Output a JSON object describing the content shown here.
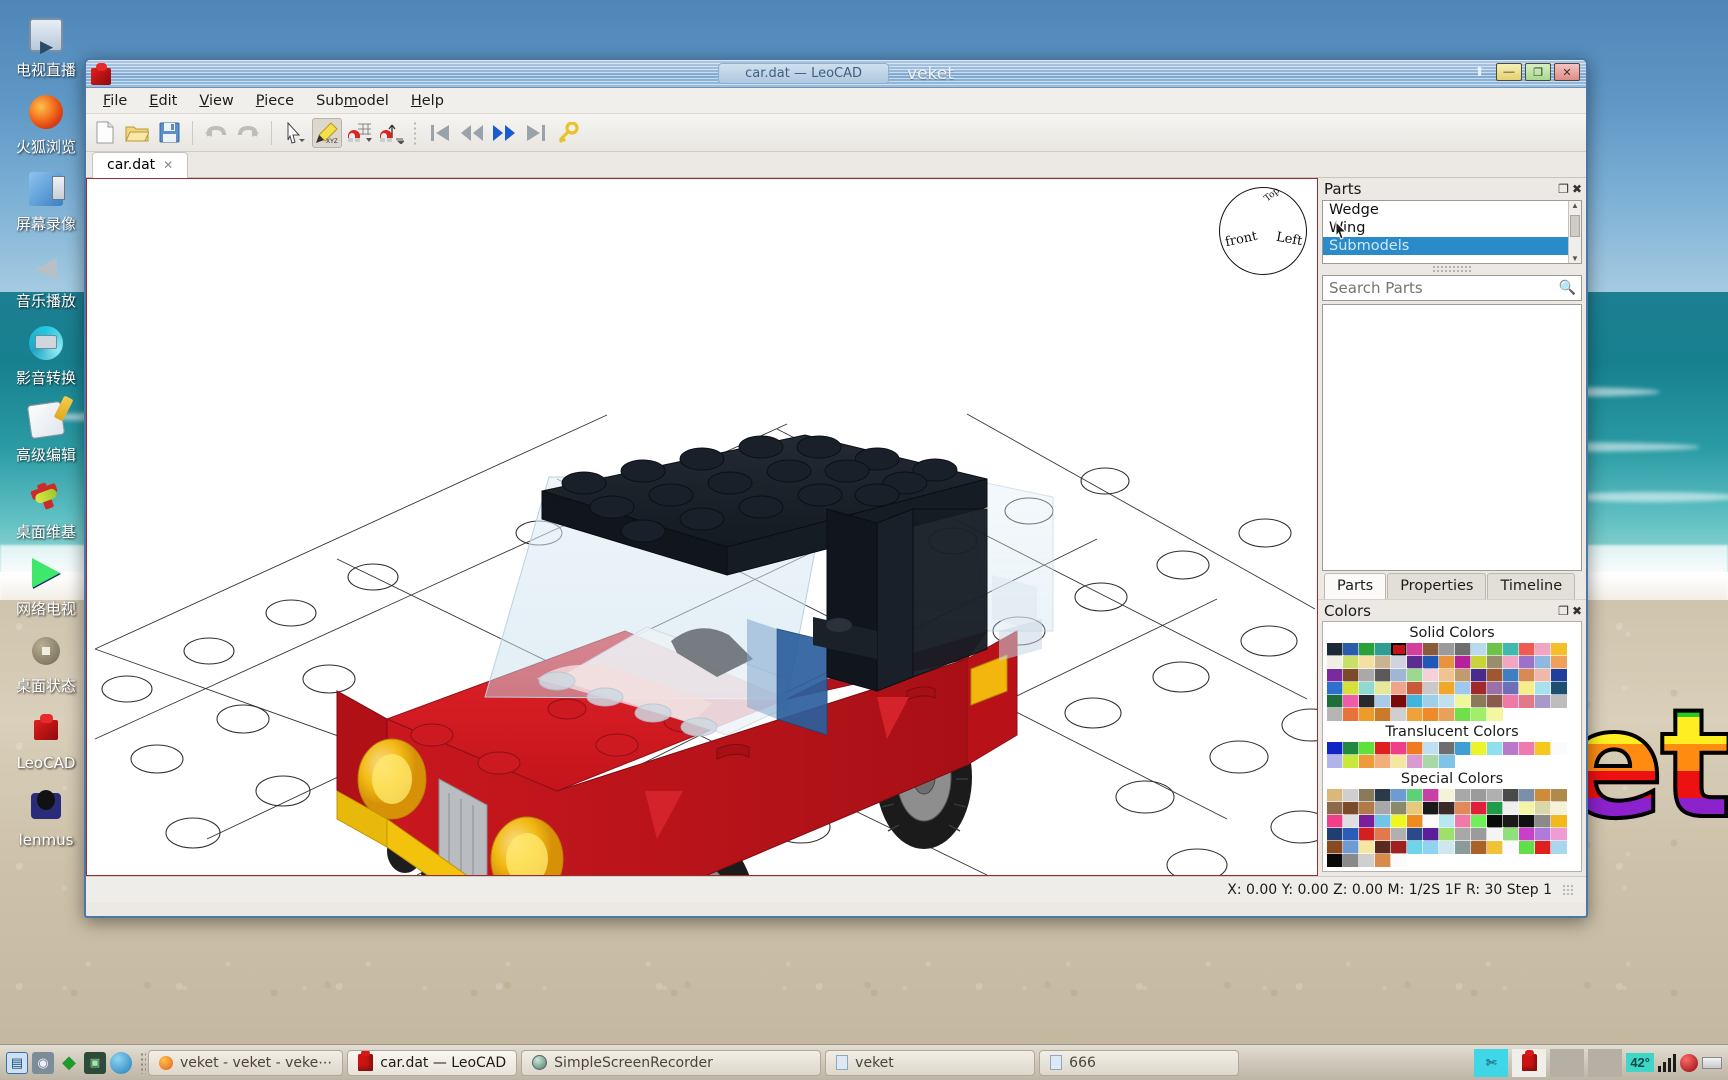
{
  "desktop": {
    "icons": [
      {
        "label": "电视直播",
        "icon": "tv-live-icon",
        "color": "#c8d4e4",
        "glyph": "▶"
      },
      {
        "label": "火狐浏览",
        "icon": "firefox-browser-icon",
        "color": "#e8701a",
        "glyph": "🦊"
      },
      {
        "label": "屏幕录像",
        "icon": "screen-recorder-icon",
        "color": "#5b9bd5",
        "glyph": "🎞"
      },
      {
        "label": "音乐播放",
        "icon": "music-player-icon",
        "color": "#9aa7b4",
        "glyph": "🔊"
      },
      {
        "label": "影音转换",
        "icon": "media-converter-icon",
        "color": "#1fb9d6",
        "glyph": "⟳"
      },
      {
        "label": "高级编辑",
        "icon": "advanced-editor-icon",
        "color": "#f0e36b",
        "glyph": "✎"
      },
      {
        "label": "桌面维基",
        "icon": "desktop-wiki-icon",
        "color": "#cf3030",
        "glyph": "✈"
      },
      {
        "label": "网络电视",
        "icon": "network-tv-icon",
        "color": "#3fdd6a",
        "glyph": "▷"
      },
      {
        "label": "桌面状态",
        "icon": "desktop-status-icon",
        "color": "#8d8676",
        "glyph": "◉"
      },
      {
        "label": "LeoCAD",
        "icon": "leocad-icon",
        "color": "#cc1414",
        "glyph": "▮"
      },
      {
        "label": "lenmus",
        "icon": "lenmus-icon",
        "color": "#2b2b6b",
        "glyph": "◐"
      }
    ],
    "wallpaper_text": "et"
  },
  "window": {
    "app_icon": "leocad-brick-icon",
    "document_title": "car.dat — LeoCAD",
    "wm_title": "veket",
    "controls": {
      "shade": "⬆",
      "minimize": "—",
      "maximize": "❐",
      "close": "✕"
    }
  },
  "menubar": {
    "items": [
      {
        "label": "File",
        "mnemonic": "F"
      },
      {
        "label": "Edit",
        "mnemonic": "E"
      },
      {
        "label": "View",
        "mnemonic": "V"
      },
      {
        "label": "Piece",
        "mnemonic": "P"
      },
      {
        "label": "Submodel",
        "mnemonic": "m"
      },
      {
        "label": "Help",
        "mnemonic": "H"
      }
    ]
  },
  "toolbar": {
    "buttons": [
      {
        "name": "new-file-button",
        "icon": "new-document-icon",
        "tooltip": "New"
      },
      {
        "name": "open-file-button",
        "icon": "open-folder-icon",
        "tooltip": "Open"
      },
      {
        "name": "save-file-button",
        "icon": "save-floppy-icon",
        "tooltip": "Save"
      },
      {
        "name": "undo-button",
        "icon": "undo-arrow-icon",
        "tooltip": "Undo"
      },
      {
        "name": "redo-button",
        "icon": "redo-arrow-icon",
        "tooltip": "Redo"
      },
      {
        "name": "select-tool-button",
        "icon": "cursor-arrow-icon",
        "tooltip": "Select"
      },
      {
        "name": "move-tool-button",
        "icon": "magic-wand-xyz-icon",
        "tooltip": "Move XYZ"
      },
      {
        "name": "snap-grid-button",
        "icon": "magnet-grid-icon",
        "tooltip": "Snap to Grid"
      },
      {
        "name": "snap-angle-button",
        "icon": "magnet-angle-icon",
        "tooltip": "Snap Angle"
      },
      {
        "name": "first-step-button",
        "icon": "skip-first-icon",
        "tooltip": "First Step"
      },
      {
        "name": "prev-step-button",
        "icon": "rewind-icon",
        "tooltip": "Previous Step"
      },
      {
        "name": "next-step-button",
        "icon": "fast-forward-icon",
        "tooltip": "Next Step"
      },
      {
        "name": "last-step-button",
        "icon": "skip-last-icon",
        "tooltip": "Last Step"
      },
      {
        "name": "key-button",
        "icon": "key-icon",
        "tooltip": "Keys"
      }
    ]
  },
  "document_tabs": [
    {
      "label": "car.dat",
      "close": "✕",
      "active": true
    }
  ],
  "viewport": {
    "model_name": "car.dat",
    "viewcube": {
      "front_label": "front",
      "left_label": "Left",
      "top_label": "Top"
    }
  },
  "parts_panel": {
    "title": "Parts",
    "float_icon": "float-panel-icon",
    "close_icon": "close-panel-icon",
    "categories": [
      {
        "label": "Wedge",
        "selected": false
      },
      {
        "label": "Wing",
        "selected": false
      },
      {
        "label": "Submodels",
        "selected": true
      }
    ],
    "search": {
      "placeholder": "Search Parts",
      "value": "",
      "icon": "search-magnifier-icon"
    }
  },
  "dock_tabs": [
    {
      "label": "Parts",
      "active": true
    },
    {
      "label": "Properties",
      "active": false
    },
    {
      "label": "Timeline",
      "active": false
    }
  ],
  "colors_panel": {
    "title": "Colors",
    "float_icon": "float-panel-icon",
    "close_icon": "close-panel-icon",
    "groups": [
      {
        "heading": "Solid Colors",
        "selected_index": 4,
        "swatches": [
          "#1b2a34",
          "#2a5ca8",
          "#2aa13a",
          "#2f9d94",
          "#c1121a",
          "#d43f9d",
          "#8a5a3c",
          "#9b9b9b",
          "#6e6e6e",
          "#b9d9ef",
          "#6fc24a",
          "#3fb9b0",
          "#ef5b52",
          "#f0a6c0",
          "#f4c02a",
          "#f0efe6",
          "#c8e06a",
          "#f5dfa3",
          "#cbb391",
          "#cfd4df",
          "#5c2d8e",
          "#1f58b5",
          "#e8943e",
          "#b4219b",
          "#c8d43a",
          "#9a8c6e",
          "#f2a6c0",
          "#9b72c9",
          "#8fb8e0",
          "#efa15a",
          "#7a2a9e",
          "#7a4a2a",
          "#a9a9a9",
          "#5a5a5a",
          "#9fb7d4",
          "#9bd98e",
          "#f6d0d8",
          "#f0c391",
          "#bf9b6e",
          "#4b2a8e",
          "#a0562e",
          "#3f7fc1",
          "#d98a54",
          "#f0b8a8",
          "#1f3f9e",
          "#2f6fcf",
          "#d6e03a",
          "#8fd9d0",
          "#e6e89a",
          "#efa58c",
          "#c85a3a",
          "#c9c9c9",
          "#f0a82a",
          "#9fc8ee",
          "#a02a2a",
          "#9b6fa8",
          "#6f6fb8",
          "#f4ef8a",
          "#a8e0ef",
          "#1f4f6e",
          "#1f6e3a",
          "#ef5ba8",
          "#2a2a2a",
          "#a8cce8",
          "#7a0a0a",
          "#3fb4e0",
          "#9fd0e8",
          "#c0e0f0",
          "#eff79a",
          "#8a7a5a",
          "#8a5a4a",
          "#ef7aa8",
          "#e07a8a",
          "#a89ac8",
          "#bdbdbd",
          "#b5b5b5",
          "#e8733a",
          "#ef9b2a",
          "#c97a2a",
          "#cfcfcf",
          "#efa13a",
          "#ef8a2a",
          "#e8a05a",
          "#6fe04a",
          "#9fef6a",
          "#f4f7a0"
        ]
      },
      {
        "heading": "Translucent Colors",
        "selected_index": -1,
        "swatches": [
          "#1225c4",
          "#1f8a3f",
          "#5fe03a",
          "#e01f1f",
          "#ef3f8a",
          "#ef7a1f",
          "#bfe0f4",
          "#6e6e6e",
          "#3f9fd4",
          "#eef22a",
          "#8fe0ef",
          "#b87ac8",
          "#ef7ab0",
          "#f4c81f",
          "#fbfbfb",
          "#b0b4e8",
          "#c8e83a",
          "#ef9b3a",
          "#efb07a",
          "#f4e8a0",
          "#d89ad0",
          "#a8d8a8",
          "#7fc4e8"
        ]
      },
      {
        "heading": "Special Colors",
        "selected_index": -1,
        "swatches": [
          "#d9b87a",
          "#cfcfcf",
          "#8a7a5a",
          "#2a3a4a",
          "#6f9bd4",
          "#5fcf7a",
          "#c83fa8",
          "#f4f2d8",
          "#a8a8a8",
          "#9b9b9b",
          "#b0b0b0",
          "#4a4a4a",
          "#7a8fa8",
          "#cf8a3a",
          "#b08a4a",
          "#8a6a4a",
          "#7a4a2a",
          "#b07a4a",
          "#a8a8a8",
          "#8a8a6a",
          "#e8c87a",
          "#1a1a1a",
          "#3a2a2a",
          "#e08a5a",
          "#e01f3a",
          "#1f9b4a",
          "#efefef",
          "#f4f4a8",
          "#d8d8a8",
          "#f4f2d8",
          "#ef3f8a",
          "#dfdfdf",
          "#7a1f9b",
          "#6fc4e8",
          "#eff71f",
          "#ef8a1f",
          "#fbfbfb",
          "#b8e8ef",
          "#ef7aa8",
          "#6fef5a",
          "#0a0a0a",
          "#1a1a1a",
          "#0f0f0f",
          "#8a8a8a",
          "#f4b81f",
          "#1f3f6e",
          "#2a5cb8",
          "#d41f1f",
          "#e07a4a",
          "#b0b0b0",
          "#2a4a8a",
          "#5c1f9b",
          "#9fe06a",
          "#a8a8a8",
          "#9b9b9b",
          "#f4f4f4",
          "#8fe07a",
          "#c83fc8",
          "#b07ad8",
          "#ef9bd4",
          "#8a4a1f",
          "#6f9bd4",
          "#f4e8a0",
          "#5a2a1f",
          "#a01f1f",
          "#6fd4e8",
          "#8fd4ef",
          "#cfe8ef",
          "#8a9b9b",
          "#a8622a",
          "#efc23a",
          "#fbfbfb",
          "#5fe04a",
          "#e01f1f",
          "#a8d8ef",
          "#0a0a0a",
          "#8a8a8a",
          "#cfcfcf",
          "#d98a4a",
          "#fbfbfb"
        ]
      }
    ]
  },
  "statusbar": {
    "text": "X: 0.00 Y: 0.00 Z: 0.00   M: 1/2S 1F R: 30   Step 1",
    "x": "0.00",
    "y": "0.00",
    "z": "0.00",
    "move_snap": "1/2S 1F",
    "rotate_snap": "30",
    "step": "Step 1"
  },
  "taskbar": {
    "launchers": [
      {
        "name": "launcher-monitor",
        "icon": "monitor-chart-icon",
        "color": "#3a6fa8",
        "glyph": "▤"
      },
      {
        "name": "launcher-camera",
        "icon": "movie-camera-icon",
        "color": "#6b7c8c",
        "glyph": "🎥"
      },
      {
        "name": "launcher-green",
        "icon": "green-diamond-icon",
        "color": "#2fa83a",
        "glyph": "◆"
      },
      {
        "name": "launcher-terminal",
        "icon": "terminal-icon",
        "color": "#2a4a3a",
        "glyph": "▣"
      },
      {
        "name": "launcher-globe",
        "icon": "globe-browser-icon",
        "color": "#2f8fcf",
        "glyph": "🌐"
      }
    ],
    "windows": [
      {
        "label": "veket - veket - veke⋯",
        "icon": "browser-icon",
        "active": false
      },
      {
        "label": "car.dat — LeoCAD",
        "icon": "leocad-brick-icon",
        "active": true
      },
      {
        "label": "SimpleScreenRecorder",
        "icon": "recorder-icon",
        "active": false
      },
      {
        "label": "veket",
        "icon": "file-manager-icon",
        "active": false
      },
      {
        "label": "666",
        "icon": "file-manager-icon",
        "active": false
      }
    ],
    "tray": [
      {
        "name": "tray-display",
        "icon": "display-scissors-icon",
        "glyph": "✄"
      },
      {
        "name": "tray-leocad",
        "icon": "leocad-brick-icon",
        "glyph": "▮"
      },
      {
        "name": "tray-empty-1",
        "icon": "empty-slot-icon",
        "glyph": ""
      },
      {
        "name": "tray-empty-2",
        "icon": "empty-slot-icon",
        "glyph": ""
      },
      {
        "name": "tray-temperature",
        "icon": "temperature-badge",
        "glyph": "42°"
      },
      {
        "name": "tray-signal",
        "icon": "signal-bars-icon",
        "glyph": "▂▄▆"
      },
      {
        "name": "tray-record",
        "icon": "record-red-dot-icon",
        "glyph": "●"
      },
      {
        "name": "tray-keyboard",
        "icon": "keyboard-icon",
        "glyph": "⌨"
      }
    ]
  }
}
